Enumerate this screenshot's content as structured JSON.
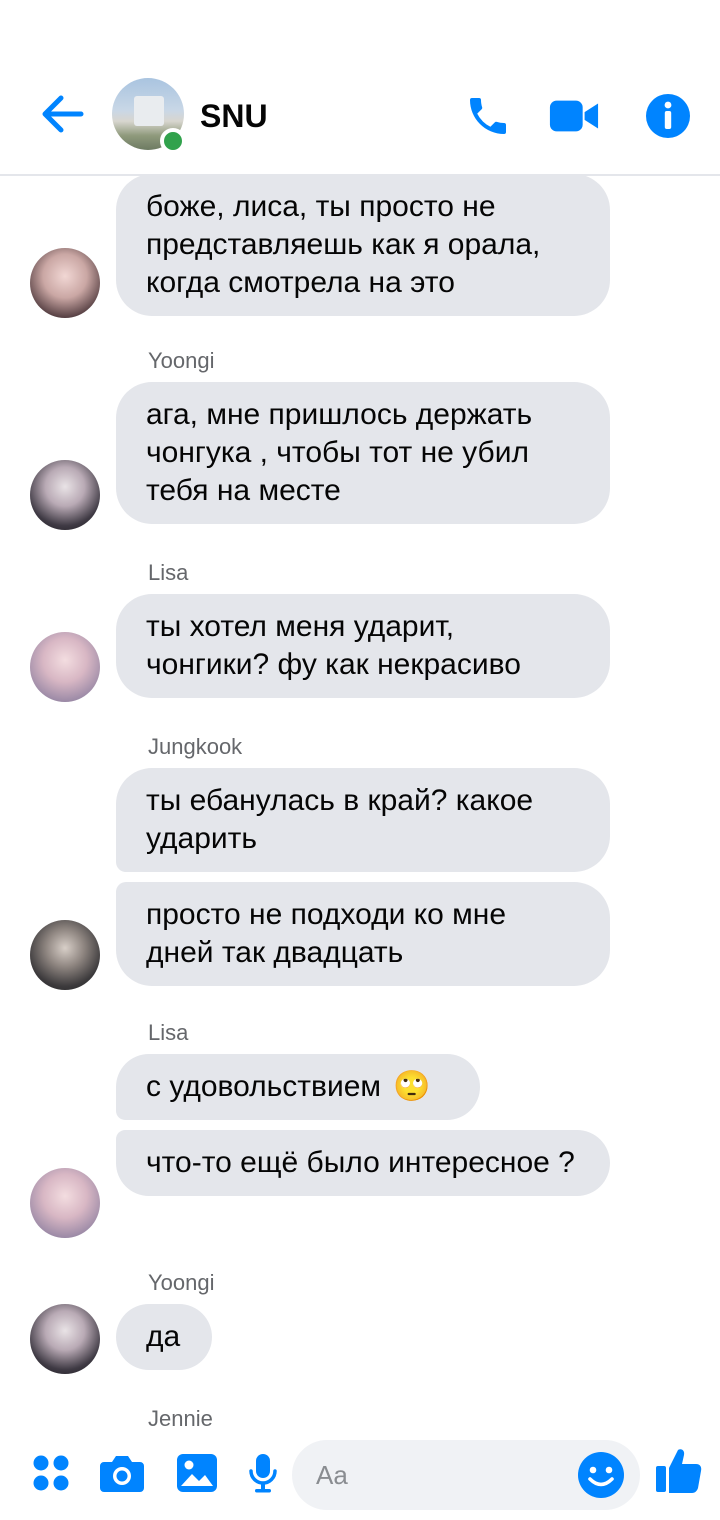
{
  "header": {
    "title": "SNU",
    "back_icon": "arrow-left-icon",
    "call_icon": "phone-icon",
    "video_icon": "video-camera-icon",
    "info_icon": "info-icon",
    "accent_color": "#0084ff",
    "online_color": "#31a24c"
  },
  "messages": [
    {
      "text": "боже, лиса, ты просто не представляешь как я орала, когда смотрела на это"
    },
    {
      "sender": "Yoongi"
    },
    {
      "text": "ага, мне пришлось держать чонгука , чтобы тот не убил тебя на месте"
    },
    {
      "sender": "Lisa"
    },
    {
      "text": "ты хотел меня ударит, чонгики? фу как некрасиво"
    },
    {
      "sender": "Jungkook"
    },
    {
      "text": "ты ебанулась в край? какое ударить"
    },
    {
      "text": "просто не подходи ко мне дней так двадцать"
    },
    {
      "sender": "Lisa"
    },
    {
      "text": "с удовольствием",
      "emoji": "🙄"
    },
    {
      "text": "что-то ещё было интересное ?"
    },
    {
      "sender": "Yoongi"
    },
    {
      "text": "да"
    },
    {
      "sender": "Jennie"
    }
  ],
  "composer": {
    "placeholder": "Aa",
    "menu_icon": "four-dots-icon",
    "camera_icon": "camera-icon",
    "gallery_icon": "image-icon",
    "mic_icon": "microphone-icon",
    "emoji_icon": "smiley-icon",
    "like_icon": "thumbs-up-icon"
  },
  "bubble_color": "#e4e6eb"
}
